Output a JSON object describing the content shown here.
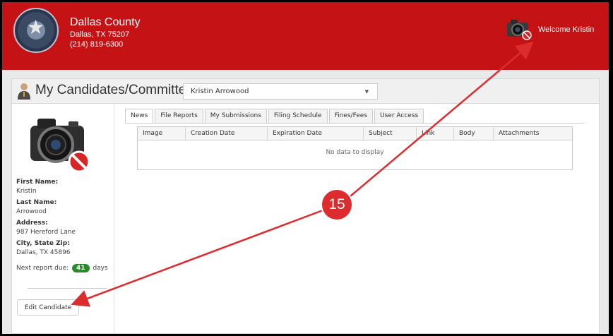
{
  "header": {
    "county": "Dallas County",
    "city": "Dallas, TX 75207",
    "phone": "(214) 819-6300",
    "welcome": "Welcome Kristin"
  },
  "panel": {
    "title": "My Candidates/Committees",
    "selected_candidate": "Kristin Arrowood"
  },
  "tabs": [
    "News",
    "File Reports",
    "My Submissions",
    "Filing Schedule",
    "Fines/Fees",
    "User Access"
  ],
  "active_tab": "News",
  "grid": {
    "columns": [
      "Image",
      "Creation Date",
      "Expiration Date",
      "Subject",
      "Link",
      "Body",
      "Attachments"
    ],
    "empty_text": "No data to display"
  },
  "candidate": {
    "first_name_label": "First Name:",
    "first_name": "Kristin",
    "last_name_label": "Last Name:",
    "last_name": "Arrowood",
    "address_label": "Address:",
    "address": "987 Hereford Lane",
    "city_label": "City, State Zip:",
    "city": "Dallas, TX 45896",
    "next_report_prefix": "Next report due:",
    "next_report_days": "41",
    "next_report_suffix": "days"
  },
  "edit_button": "Edit Candidate",
  "annotation": {
    "marker": "15",
    "color": "#dd2c2e"
  },
  "colors": {
    "header": "#c51215",
    "badge": "#2a8a2a"
  },
  "icons": [
    "county-seal-icon",
    "camera-icon",
    "person-icon",
    "caret-down-icon"
  ]
}
